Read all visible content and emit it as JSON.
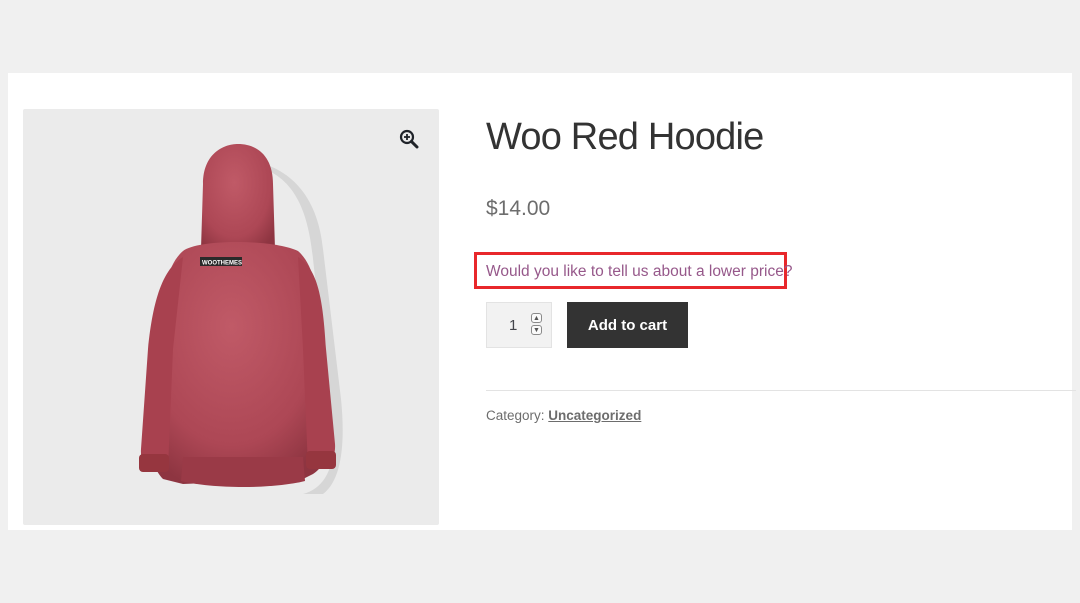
{
  "product": {
    "title": "Woo Red Hoodie",
    "price": "$14.00",
    "offer_link": "Would you like to tell us about a lower price?",
    "quantity": "1",
    "add_to_cart_label": "Add to cart",
    "category_label": "Category:",
    "category_value": "Uncategorized",
    "image_logo_text": "WOOTHEMES"
  },
  "icons": {
    "zoom": "zoom-in-icon",
    "spin_up": "chevron-up-icon",
    "spin_down": "chevron-down-icon"
  },
  "colors": {
    "page_bg": "#f0f0f0",
    "card_bg": "#ffffff",
    "link": "#96588a",
    "highlight_border": "#e8282b",
    "button_bg": "#333333",
    "hoodie": "#b44b58"
  }
}
